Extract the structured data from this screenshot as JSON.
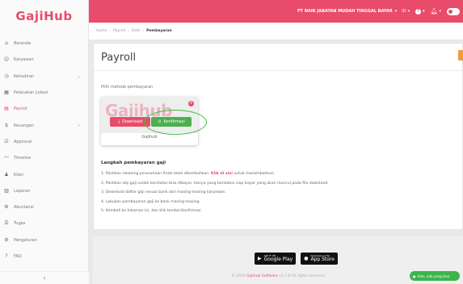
{
  "app": {
    "logo_text": "GajiHub"
  },
  "topbar": {
    "company": "PT NAIK JABATAN MUDAH TINGGAL BAYAR",
    "lang": "ID",
    "help_label": "?"
  },
  "sidebar": {
    "items": [
      {
        "label": "Beranda",
        "icon": "home-icon",
        "glyph": "⌂",
        "chevron": false
      },
      {
        "label": "Karyawan",
        "icon": "user-icon",
        "glyph": "☺",
        "chevron": false
      },
      {
        "label": "Kehadiran",
        "icon": "clock-icon",
        "glyph": "◷",
        "chevron": true
      },
      {
        "label": "Pelacakan Lokasi",
        "icon": "map-icon",
        "glyph": "▦",
        "chevron": false
      },
      {
        "label": "Payroll",
        "icon": "payroll-icon",
        "glyph": "▤",
        "chevron": false,
        "active": true
      },
      {
        "label": "Keuangan",
        "icon": "finance-icon",
        "glyph": "$",
        "chevron": true
      },
      {
        "label": "Approval",
        "icon": "approval-icon",
        "glyph": "☑",
        "chevron": false
      },
      {
        "label": "Timeline",
        "icon": "timeline-icon",
        "glyph": "〰",
        "chevron": false
      },
      {
        "label": "Klien",
        "icon": "client-icon",
        "glyph": "♟",
        "chevron": false
      },
      {
        "label": "Laporan",
        "icon": "report-icon",
        "glyph": "▥",
        "chevron": false
      },
      {
        "label": "Akuntansi",
        "icon": "accounting-icon",
        "glyph": "⚙",
        "chevron": false
      },
      {
        "label": "Tugas",
        "icon": "task-icon",
        "glyph": "☰",
        "chevron": false
      },
      {
        "label": "Pengaturan",
        "icon": "settings-icon",
        "glyph": "⚙",
        "chevron": false
      },
      {
        "label": "FAQ",
        "icon": "faq-icon",
        "glyph": "?",
        "chevron": false
      }
    ],
    "collapse_glyph": "‹"
  },
  "breadcrumb": {
    "items": [
      "Home",
      "Payroll",
      "Detil"
    ],
    "current": "Pembayaran",
    "separator": "›"
  },
  "main": {
    "title": "Payroll",
    "method_label": "Pilih metode pembayaran",
    "method_card": {
      "watermark": "Gajihub",
      "name": "Gajihub",
      "download_label": "Download",
      "konfirmasi_label": "Konfirmasi",
      "close_glyph": "×"
    },
    "steps_title": "Langkah pembayaran gaji",
    "steps": [
      {
        "before": "1. Pastikan rekening perusahaan Anda telah ditambahkan. ",
        "link": "Klik di sini",
        "after": " untuk menambahkan."
      },
      {
        "before": "2. Pastikan slip gaji sudah berstatus bisa dibayar. Hanya yang berstatus siap bayar yang akan muncul pada file download.",
        "link": "",
        "after": ""
      },
      {
        "before": "3. Download daftar gaji sesuai bank dari masing-masing karyawan.",
        "link": "",
        "after": ""
      },
      {
        "before": "4. Lakukan pembayaran gaji ke bank masing-masing.",
        "link": "",
        "after": ""
      },
      {
        "before": "5. Kembali ke halaman ini, dan klik tombol Konfirmasi.",
        "link": "",
        "after": ""
      }
    ]
  },
  "footer": {
    "google_small": "GET IT ON",
    "google_big": "Google Play",
    "apple_small": "Download on the",
    "apple_big": "App Store",
    "copyright_before": "© 2024 ",
    "copyright_link": "Gajihub Software",
    "copyright_after": " v1.7.8 All rights reserved"
  },
  "chat": {
    "label": "Halo, ada yang bisa"
  },
  "colors": {
    "brand": "#e94b6a",
    "success": "#4caf50",
    "accent": "#f39c3c"
  }
}
